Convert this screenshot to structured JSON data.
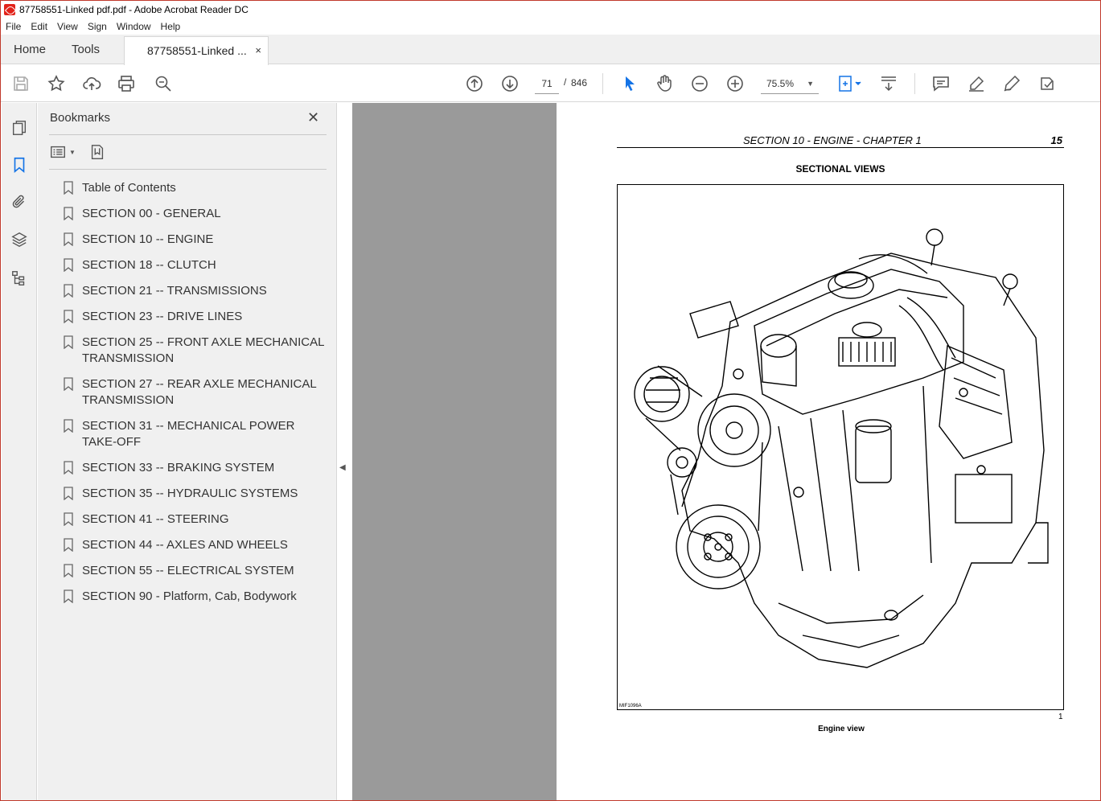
{
  "window": {
    "title": "87758551-Linked pdf.pdf - Adobe Acrobat Reader DC"
  },
  "menu": [
    "File",
    "Edit",
    "View",
    "Sign",
    "Window",
    "Help"
  ],
  "tabs": {
    "home": "Home",
    "tools": "Tools",
    "document": "87758551-Linked ...",
    "close": "×"
  },
  "toolbar": {
    "page_current": "71",
    "page_separator": "/",
    "page_total": "846",
    "zoom": "75.5%"
  },
  "bookmarks": {
    "title": "Bookmarks",
    "close": "✕",
    "items": [
      "Table of Contents",
      "SECTION 00 - GENERAL",
      "SECTION 10 -- ENGINE",
      "SECTION 18 -- CLUTCH",
      "SECTION 21 -- TRANSMISSIONS",
      "SECTION 23 -- DRIVE LINES",
      "SECTION 25 -- FRONT AXLE MECHANICAL TRANSMISSION",
      "SECTION 27 -- REAR AXLE MECHANICAL TRANSMISSION",
      "SECTION 31 -- MECHANICAL POWER TAKE-OFF",
      "SECTION 33 -- BRAKING SYSTEM",
      "SECTION 35 -- HYDRAULIC SYSTEMS",
      "SECTION 41 -- STEERING",
      "SECTION 44 -- AXLES AND WHEELS",
      "SECTION 55 -- ELECTRICAL SYSTEM",
      "SECTION 90 - Platform, Cab, Bodywork"
    ]
  },
  "page": {
    "section_header": "SECTION 10 - ENGINE - CHAPTER 1",
    "page_number": "15",
    "heading": "SECTIONAL VIEWS",
    "figure_code": "MIF1096A",
    "figure_number": "1",
    "caption": "Engine view"
  },
  "colors": {
    "accent_blue": "#1473e6",
    "doc_background": "#9a9a9a",
    "panel_bg": "#f0f0f0",
    "window_border": "#c0392b"
  }
}
